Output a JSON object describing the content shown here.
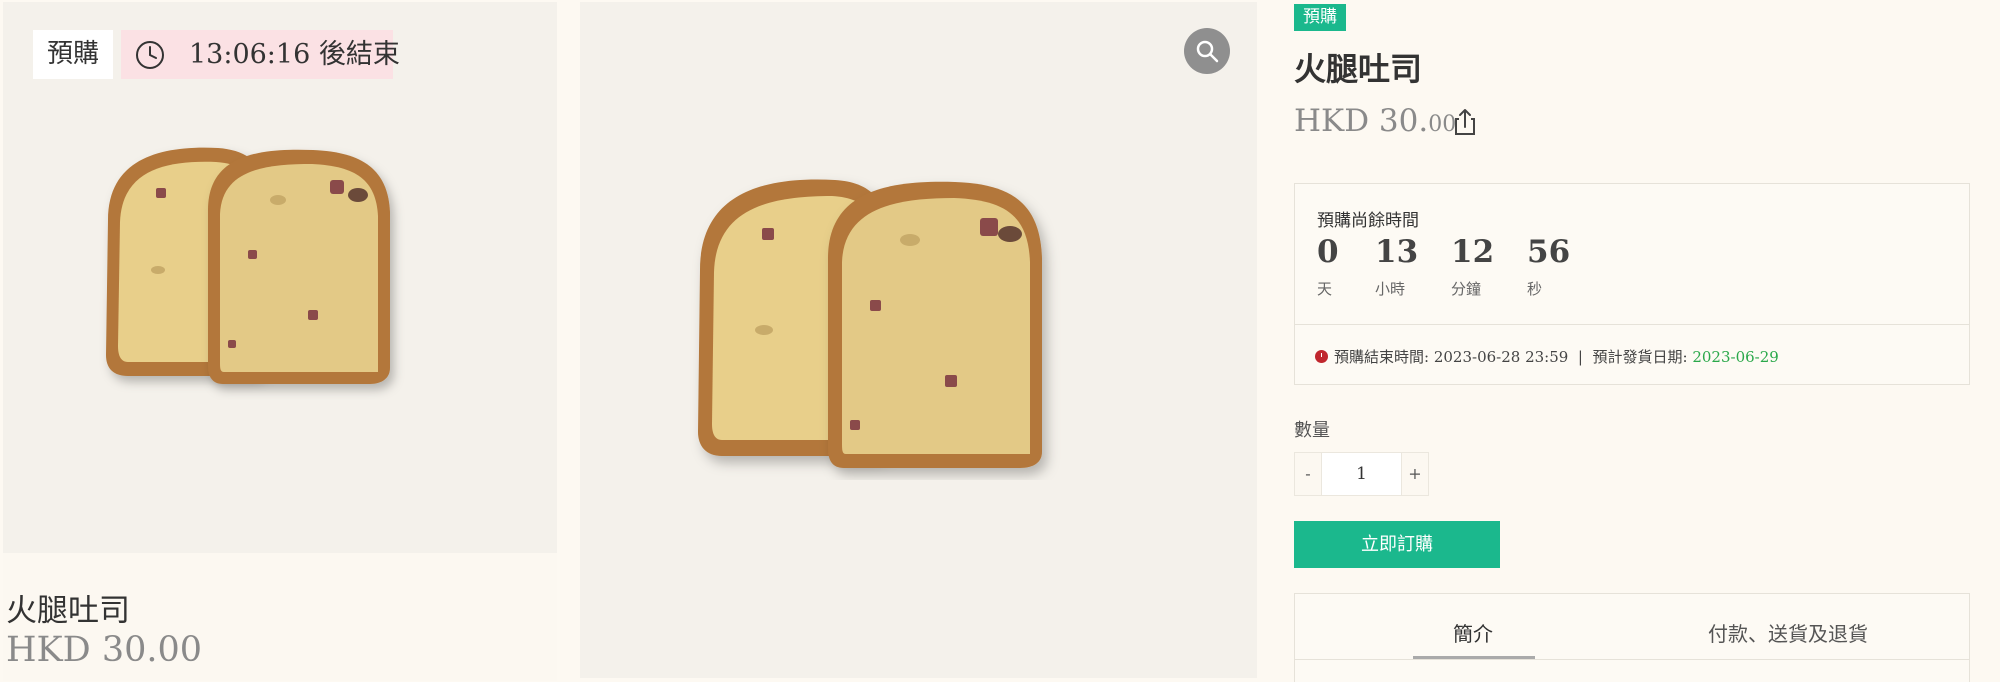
{
  "card": {
    "badge_preorder": "預購",
    "countdown_text": "13:06:16 後結束",
    "name": "火腿吐司",
    "price": "HKD 30.00"
  },
  "product": {
    "tag": "預購",
    "title": "火腿吐司",
    "price_main": "HKD 30.",
    "price_cents": "00"
  },
  "countdown": {
    "label": "預購尚餘時間",
    "days": "0",
    "days_label": "天",
    "hours": "13",
    "hours_label": "小時",
    "minutes": "12",
    "minutes_label": "分鐘",
    "seconds": "56",
    "seconds_label": "秒",
    "end_label": "預購結束時間:",
    "end_value": "2023-06-28 23:59",
    "separator": "|",
    "ship_label": "預計發貨日期:",
    "ship_value": "2023-06-29",
    "ship_color": "#2aa84a"
  },
  "quantity": {
    "label": "數量",
    "minus": "-",
    "value": "1",
    "plus": "+"
  },
  "buy_button": "立即訂購",
  "tabs": [
    "簡介",
    "付款、送貨及退貨"
  ],
  "icons": {
    "clock": "clock-icon",
    "zoom": "search-icon",
    "share": "share-icon",
    "end_time": "clock-dot-icon"
  },
  "colors": {
    "accent": "#1bb88d",
    "timer_badge": "#fbe1e4",
    "end_dot": "#c0262d"
  }
}
